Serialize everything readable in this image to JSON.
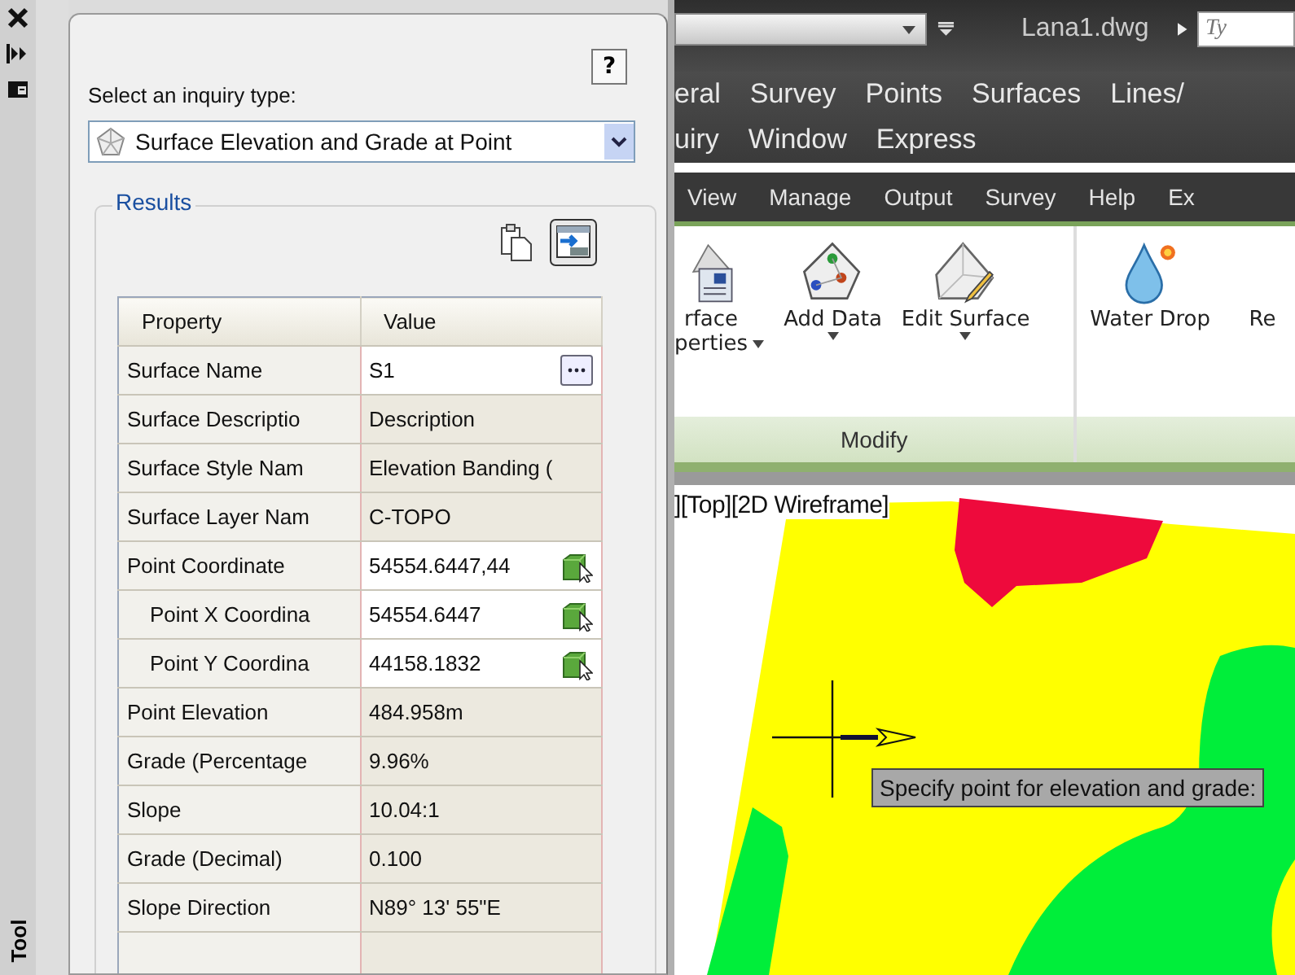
{
  "palette": {
    "title": "Tool"
  },
  "inquiry": {
    "help_button": "?",
    "label": "Select an inquiry type:",
    "inquiry_type": "Surface Elevation and Grade at Point",
    "results": {
      "title": "Results",
      "table": {
        "columns": [
          "Property",
          "Value"
        ],
        "rows": [
          {
            "property": "Surface Name",
            "value": "S1",
            "editable": true,
            "kind": "browse"
          },
          {
            "property": "Surface Descriptio",
            "value": "Description",
            "editable": false
          },
          {
            "property": "Surface Style Nam",
            "value": "Elevation Banding (",
            "editable": false
          },
          {
            "property": "Surface Layer Nam",
            "value": "C-TOPO",
            "editable": false
          },
          {
            "property": "Point Coordinate",
            "value": "54554.6447,44",
            "editable": true,
            "kind": "pick",
            "children": [
              {
                "property": "Point X Coordina",
                "value": "54554.6447",
                "editable": true,
                "kind": "pick"
              },
              {
                "property": "Point Y Coordina",
                "value": "44158.1832",
                "editable": true,
                "kind": "pick"
              }
            ]
          },
          {
            "property": "Point Elevation",
            "value": "484.958m",
            "editable": false
          },
          {
            "property": "Grade (Percentage",
            "value": "9.96%",
            "editable": false
          },
          {
            "property": "Slope",
            "value": "10.04:1",
            "editable": false
          },
          {
            "property": "Grade (Decimal)",
            "value": "0.100",
            "editable": false
          },
          {
            "property": "Slope Direction",
            "value": "N89° 13' 55\"E",
            "editable": false
          }
        ]
      }
    }
  },
  "app": {
    "document_title": "Lana1.dwg",
    "search_placeholder": "Ty",
    "menu_rows": [
      [
        "eral",
        "Survey",
        "Points",
        "Surfaces",
        "Lines/"
      ],
      [
        "uiry",
        "Window",
        "Express"
      ]
    ],
    "ribbon_tabs": [
      "View",
      "Manage",
      "Output",
      "Survey",
      "Help",
      "Ex"
    ],
    "ribbon_panels": [
      {
        "title": "Modify",
        "buttons": [
          {
            "kind": "properties",
            "lines": [
              "rface",
              "perties"
            ],
            "dropdown": true
          },
          {
            "kind": "add-data",
            "lines": [
              "Add Data"
            ],
            "dropdown": true
          },
          {
            "kind": "edit",
            "lines": [
              "Edit Surface"
            ],
            "dropdown": true
          }
        ]
      },
      {
        "buttons": [
          {
            "kind": "water-drop",
            "lines": [
              "Water Drop"
            ],
            "dropdown": false
          },
          {
            "kind": "plain",
            "lines": [
              "Re"
            ],
            "dropdown": false
          }
        ]
      }
    ],
    "viewport_label": "][Top][2D Wireframe]",
    "tooltip": "Specify point for elevation and grade:"
  }
}
